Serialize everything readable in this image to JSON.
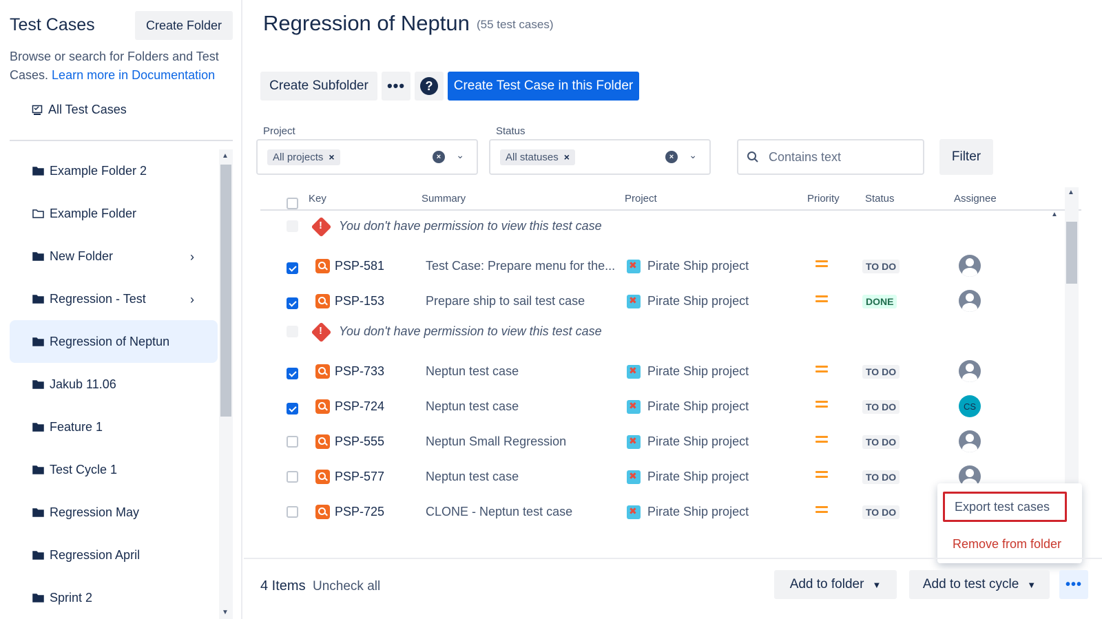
{
  "sidebar": {
    "title": "Test Cases",
    "create_folder": "Create Folder",
    "desc_text": "Browse or search for Folders and Test Cases.",
    "desc_link": "Learn more in Documentation",
    "all_test_cases": "All Test Cases",
    "folders": [
      {
        "label": "Example Folder 2",
        "filled": true,
        "expandable": false,
        "active": false
      },
      {
        "label": "Example Folder",
        "filled": false,
        "expandable": false,
        "active": false
      },
      {
        "label": "New Folder",
        "filled": true,
        "expandable": true,
        "active": false
      },
      {
        "label": "Regression - Test",
        "filled": true,
        "expandable": true,
        "active": false
      },
      {
        "label": "Regression of Neptun",
        "filled": true,
        "expandable": false,
        "active": true
      },
      {
        "label": "Jakub 11.06",
        "filled": true,
        "expandable": false,
        "active": false
      },
      {
        "label": "Feature 1",
        "filled": true,
        "expandable": false,
        "active": false
      },
      {
        "label": "Test Cycle 1",
        "filled": true,
        "expandable": false,
        "active": false
      },
      {
        "label": "Regression May",
        "filled": true,
        "expandable": false,
        "active": false
      },
      {
        "label": "Regression April",
        "filled": true,
        "expandable": false,
        "active": false
      },
      {
        "label": "Sprint 2",
        "filled": true,
        "expandable": false,
        "active": false
      }
    ]
  },
  "header": {
    "title": "Regression of Neptun",
    "count": "(55 test cases)"
  },
  "toolbar": {
    "create_subfolder": "Create Subfolder",
    "more": "•••",
    "help": "?",
    "create_test_case": "Create Test Case in this Folder"
  },
  "filters": {
    "project_label": "Project",
    "project_value": "All projects",
    "status_label": "Status",
    "status_value": "All statuses",
    "search_placeholder": "Contains text",
    "filter_button": "Filter"
  },
  "table": {
    "columns": {
      "key": "Key",
      "summary": "Summary",
      "project": "Project",
      "priority": "Priority",
      "status": "Status",
      "assignee": "Assignee"
    },
    "rows": [
      {
        "no_permission": true,
        "message": "You don't have permission to view this test case"
      },
      {
        "checked": true,
        "key": "PSP-581",
        "summary": "Test Case: Prepare menu for the...",
        "project": "Pirate Ship project",
        "status": "TO DO",
        "assignee": "avatar"
      },
      {
        "checked": true,
        "key": "PSP-153",
        "summary": "Prepare ship to sail test case",
        "project": "Pirate Ship project",
        "status": "DONE",
        "assignee": "avatar"
      },
      {
        "no_permission": true,
        "message": "You don't have permission to view this test case"
      },
      {
        "checked": true,
        "key": "PSP-733",
        "summary": "Neptun test case",
        "project": "Pirate Ship project",
        "status": "TO DO",
        "assignee": "avatar"
      },
      {
        "checked": true,
        "key": "PSP-724",
        "summary": "Neptun test case",
        "project": "Pirate Ship project",
        "status": "TO DO",
        "assignee": "CS"
      },
      {
        "checked": false,
        "key": "PSP-555",
        "summary": "Neptun Small Regression",
        "project": "Pirate Ship project",
        "status": "TO DO",
        "assignee": "avatar"
      },
      {
        "checked": false,
        "key": "PSP-577",
        "summary": "Neptun test case",
        "project": "Pirate Ship project",
        "status": "TO DO",
        "assignee": "avatar"
      },
      {
        "checked": false,
        "key": "PSP-725",
        "summary": "CLONE - Neptun test case",
        "project": "Pirate Ship project",
        "status": "TO DO",
        "assignee": "none"
      }
    ]
  },
  "popup_menu": {
    "export": "Export test cases",
    "remove": "Remove from folder"
  },
  "bottom_bar": {
    "items_count": "4 Items",
    "uncheck_all": "Uncheck all",
    "add_to_folder": "Add to folder",
    "add_to_cycle": "Add to test cycle",
    "more": "•••"
  },
  "colors": {
    "primary": "#0c66e4",
    "active_folder": "#e9f2ff",
    "testcase_icon": "#f26a21",
    "priority": "#ff991f",
    "danger": "#c9372c",
    "highlight_border": "#d0252d"
  }
}
